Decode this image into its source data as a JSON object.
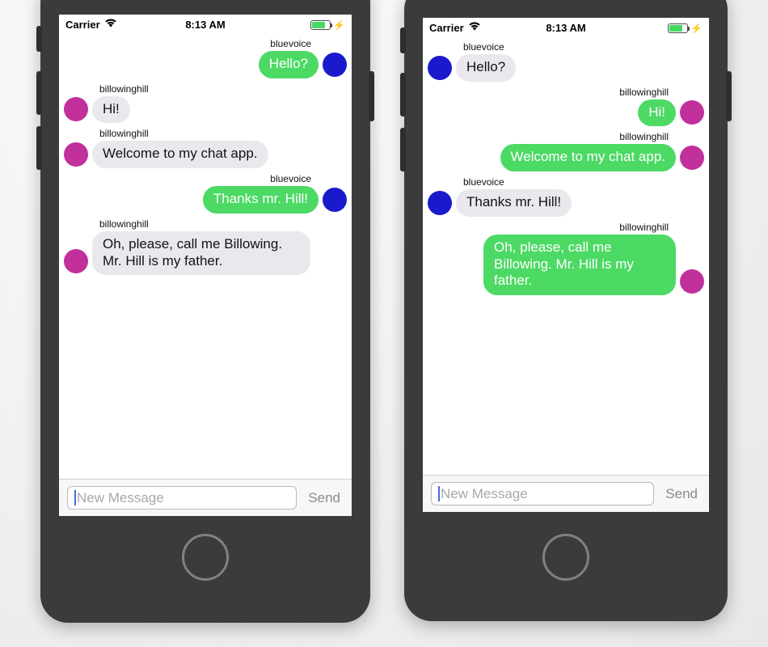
{
  "scene": {
    "description": "Two iPhone mockups side by side showing the same chat conversation from two different accounts"
  },
  "colors": {
    "bubble_green": "#4cd964",
    "bubble_grey": "#e8e8ed",
    "avatar_blue": "#1a1acc",
    "avatar_magenta": "#c2309b",
    "phone_body": "#3b3b3b",
    "battery_green": "#45d962",
    "caret_blue": "#3f6fe0"
  },
  "status_bar": {
    "carrier": "Carrier",
    "wifi_icon": "wifi-icon",
    "time": "8:13 AM",
    "battery_icon": "battery-icon",
    "battery_level_percent": 78,
    "charging_icon": "lightning-bolt-icon"
  },
  "input_bar": {
    "placeholder": "New Message",
    "value": "",
    "send_label": "Send"
  },
  "phones": [
    {
      "id": "left-phone",
      "account": "bluevoice",
      "messages": [
        {
          "sender": "bluevoice",
          "text": "Hello?",
          "side": "out",
          "bubble": "green",
          "avatar": "blue"
        },
        {
          "sender": "billowinghill",
          "text": "Hi!",
          "side": "in",
          "bubble": "grey",
          "avatar": "magenta"
        },
        {
          "sender": "billowinghill",
          "text": "Welcome to my chat app.",
          "side": "in",
          "bubble": "grey",
          "avatar": "magenta"
        },
        {
          "sender": "bluevoice",
          "text": "Thanks mr. Hill!",
          "side": "out",
          "bubble": "green",
          "avatar": "blue"
        },
        {
          "sender": "billowinghill",
          "text": "Oh, please, call me Billowing. Mr. Hill is my father.",
          "side": "in",
          "bubble": "grey",
          "avatar": "magenta"
        }
      ]
    },
    {
      "id": "right-phone",
      "account": "billowinghill",
      "messages": [
        {
          "sender": "bluevoice",
          "text": "Hello?",
          "side": "in",
          "bubble": "grey",
          "avatar": "blue"
        },
        {
          "sender": "billowinghill",
          "text": "Hi!",
          "side": "out",
          "bubble": "green",
          "avatar": "magenta"
        },
        {
          "sender": "billowinghill",
          "text": "Welcome to my chat app.",
          "side": "out",
          "bubble": "green",
          "avatar": "magenta"
        },
        {
          "sender": "bluevoice",
          "text": "Thanks mr. Hill!",
          "side": "in",
          "bubble": "grey",
          "avatar": "blue"
        },
        {
          "sender": "billowinghill",
          "text": "Oh, please, call me Billowing. Mr. Hill is my father.",
          "side": "out",
          "bubble": "green",
          "avatar": "magenta"
        }
      ]
    }
  ]
}
